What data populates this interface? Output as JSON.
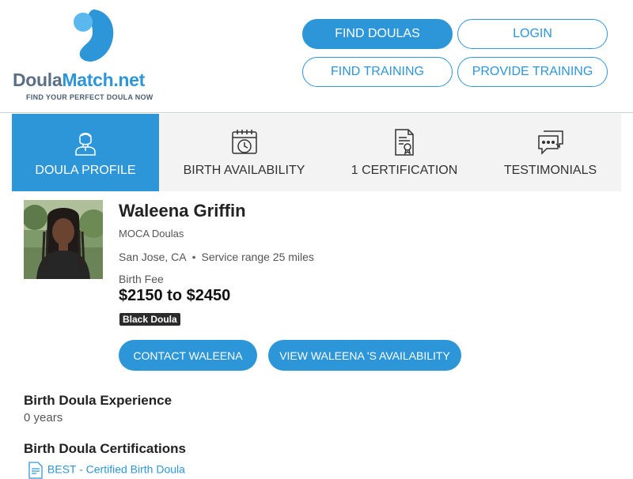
{
  "brand": {
    "name_part1": "Doula",
    "name_part2": "Match.net",
    "tagline": "FIND YOUR PERFECT DOULA NOW",
    "colors": {
      "accent": "#2d96d8",
      "accent_light": "#5ab8ee",
      "slate": "#5a6f86"
    }
  },
  "nav": {
    "find_doulas": "FIND DOULAS",
    "login": "LOGIN",
    "find_training": "FIND TRAINING",
    "provide_training": "PROVIDE TRAINING"
  },
  "tabs": [
    {
      "label": "DOULA PROFILE",
      "icon": "person-icon",
      "active": true
    },
    {
      "label": "BIRTH AVAILABILITY",
      "icon": "calendar-clock-icon",
      "active": false
    },
    {
      "label": "1 CERTIFICATION",
      "icon": "certificate-icon",
      "active": false
    },
    {
      "label": "TESTIMONIALS",
      "icon": "chat-bubbles-icon",
      "active": false
    }
  ],
  "profile": {
    "name": "Waleena Griffin",
    "agency": "MOCA Doulas",
    "location": "San Jose, CA",
    "separator": "•",
    "service_range": "Service range 25 miles",
    "fee_label": "Birth Fee",
    "fee": "$2150 to $2450",
    "badge": "Black Doula"
  },
  "actions": {
    "contact": "CONTACT WALEENA",
    "availability": "VIEW WALEENA 'S AVAILABILITY"
  },
  "experience": {
    "title": "Birth Doula Experience",
    "value": "0 years"
  },
  "certifications": {
    "title": "Birth Doula Certifications",
    "items": [
      "BEST - Certified Birth Doula"
    ]
  }
}
